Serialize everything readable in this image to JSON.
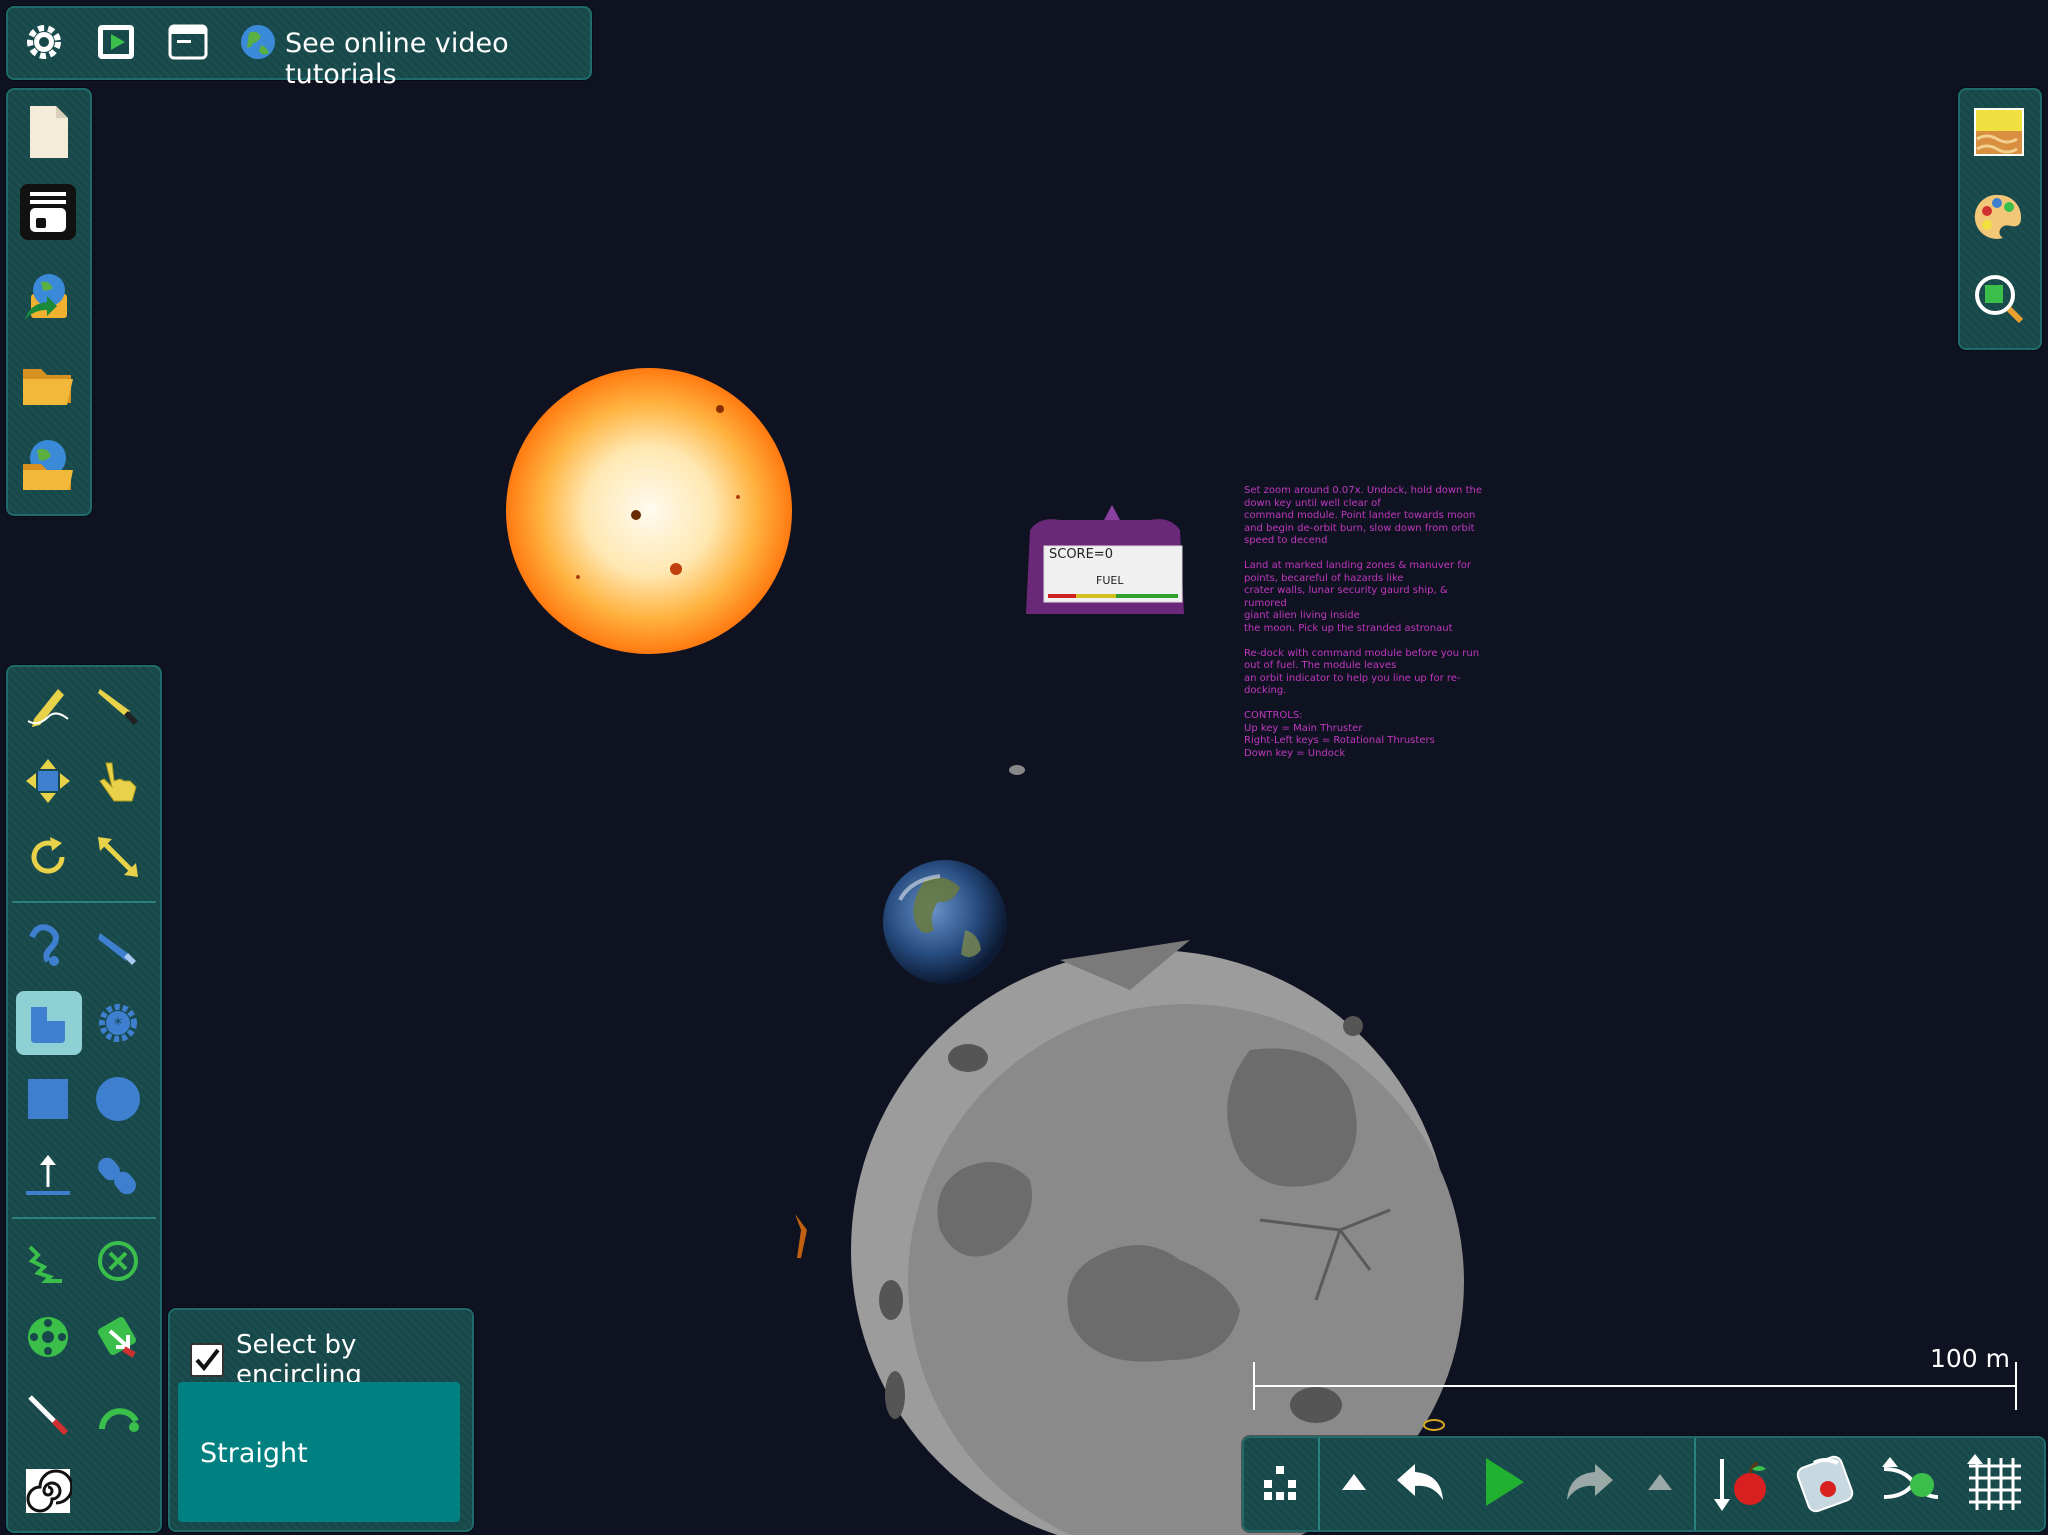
{
  "top_bar": {
    "tutorials_label": "See online video tutorials",
    "icons": [
      "gear-icon",
      "play-video-icon",
      "window-icon",
      "globe-icon"
    ]
  },
  "left_top_toolbar": {
    "items": [
      "new-file-icon",
      "layers-icon",
      "import-scene-icon",
      "open-folder-icon",
      "open-online-icon"
    ]
  },
  "tools": {
    "items": [
      "sketch-tool-icon",
      "knife-tool-icon",
      "move-tool-icon",
      "drag-tool-icon",
      "rotate-tool-icon",
      "scale-tool-icon",
      "rope-tool-icon",
      "brush-tool-icon",
      "polygon-tool-icon",
      "gear-shape-tool-icon",
      "box-tool-icon",
      "circle-tool-icon",
      "plane-tool-icon",
      "chain-tool-icon",
      "spring-tool-icon",
      "fixate-tool-icon",
      "axle-tool-icon",
      "tracer-tool-icon",
      "laser-tool-icon",
      "hinge-tool-icon",
      "spiral-tool-icon"
    ],
    "selected": "polygon-tool-icon"
  },
  "select_panel": {
    "checkbox_checked": true,
    "checkbox_label": "Select by encircling",
    "mode_label": "Straight"
  },
  "right_toolbar": {
    "items": [
      "background-icon",
      "palette-icon",
      "zoom-to-scene-icon"
    ]
  },
  "bottom_bar": {
    "items": [
      "structure-icon",
      "up-arrow-icon",
      "undo-icon",
      "play-icon",
      "redo-icon",
      "up-arrow-icon",
      "gravity-icon",
      "air-icon",
      "simulation-speed-icon",
      "grid-icon"
    ]
  },
  "scene": {
    "score_text": "SCORE=0",
    "fuel_text": "FUEL",
    "instructions": "Set zoom around 0.07x.  Undock, hold down the\ndown key until well clear of\ncommand module. Point lander towards moon\nand begin de-orbit burn, slow down from orbit\nspeed to decend\n\nLand at marked landing zones & manuver for\npoints, becareful of hazards like\n crater walls, lunar security gaurd ship, & rumored\n giant alien living inside\nthe moon. Pick up the stranded astronaut\n\nRe-dock with command module before you run\nout of fuel. The module leaves\nan orbit indicator to help you line up for re-\ndocking.\n\nCONTROLS:\nUp key = Main Thruster\nRight-Left keys = Rotational Thrusters\nDown key = Undock",
    "scale_label": "100 m"
  },
  "colors": {
    "background": "#0f1220",
    "panel": "#17484a",
    "accent_teal": "#008080",
    "selected": "#8fd0d4",
    "text_magenta": "#c038c0",
    "icon_yellow": "#e8d24a",
    "icon_blue": "#3f7fd0"
  }
}
